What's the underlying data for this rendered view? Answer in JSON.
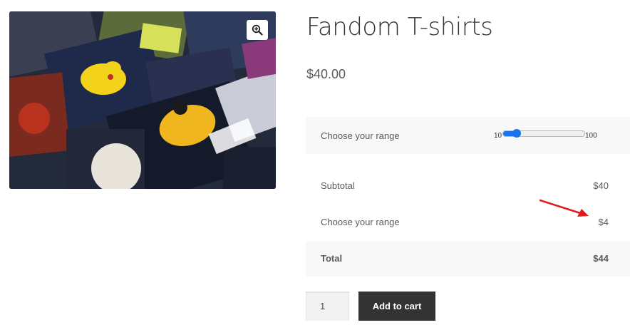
{
  "product": {
    "title": "Fandom T-shirts",
    "price": "$40.00",
    "image_icon": "zoom-in-icon"
  },
  "range_option": {
    "label": "Choose your range",
    "min_label": "10",
    "max_label": "100",
    "min": 10,
    "max": 100,
    "value": 25
  },
  "totals": {
    "subtotal_label": "Subtotal",
    "subtotal_value": "$40",
    "range_label": "Choose your range",
    "range_value": "$4",
    "total_label": "Total",
    "total_value": "$44"
  },
  "cart": {
    "quantity": "1",
    "add_label": "Add to cart"
  },
  "colors": {
    "slider_accent": "#1a73e8",
    "button_bg": "#333333",
    "annotation_arrow": "#e01b1b"
  }
}
